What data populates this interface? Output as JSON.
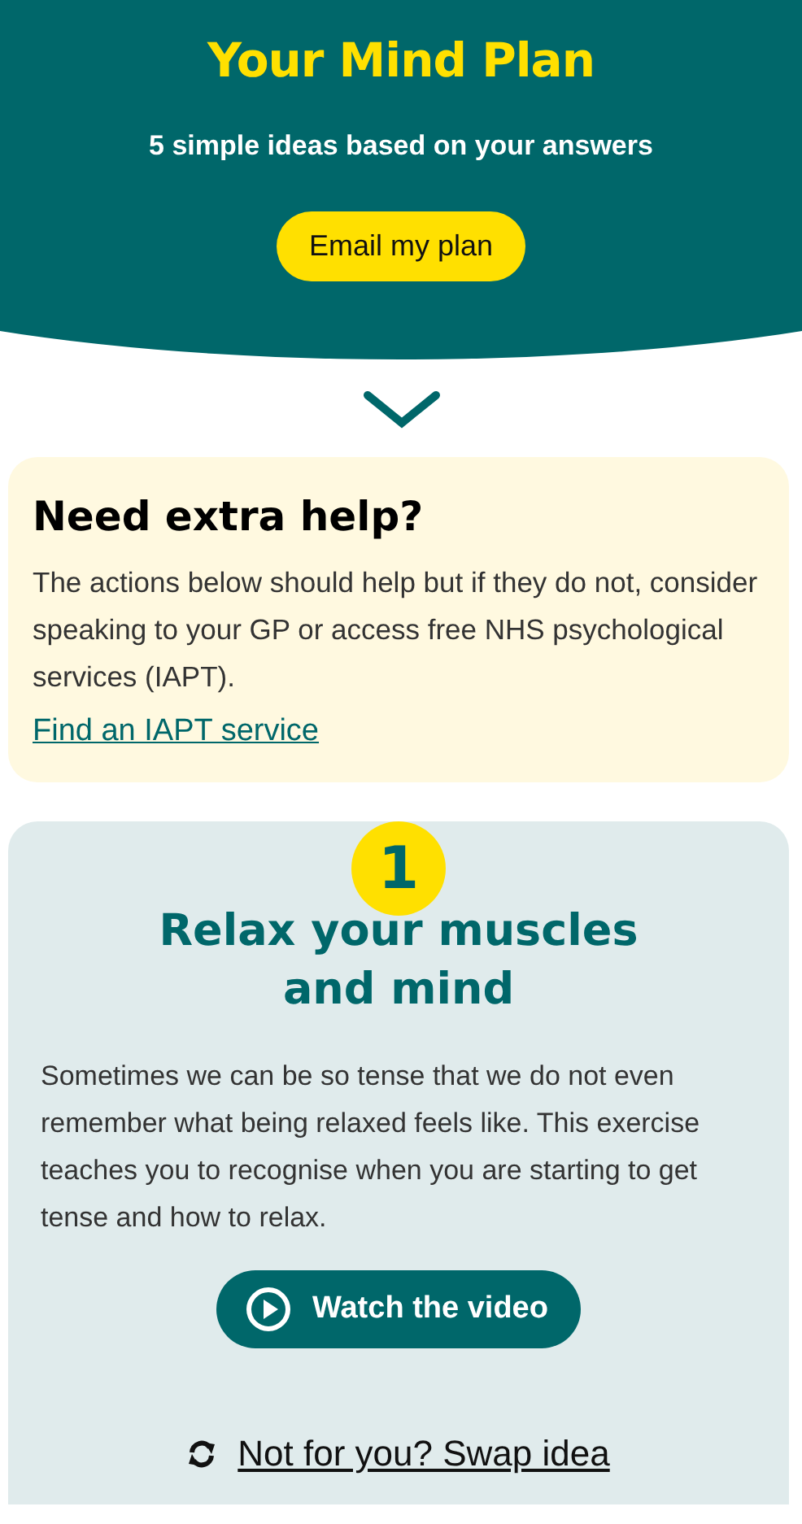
{
  "header": {
    "title": "Your Mind Plan",
    "subtitle": "5 simple ideas based on your answers",
    "button": "Email my plan"
  },
  "help": {
    "title": "Need extra help?",
    "text": "The actions below should help but if they do not, consider speaking to your GP or access free NHS psychological services (IAPT).",
    "link": "Find an IAPT service"
  },
  "idea": {
    "number": "1",
    "title": "Relax your muscles and mind",
    "text": "Sometimes we can be so tense that we do not even remember what being relaxed feels like. This exercise teaches you to recognise when you are starting to get tense and how to relax.",
    "button": "Watch the video",
    "swap": "Not for you? Swap idea"
  }
}
